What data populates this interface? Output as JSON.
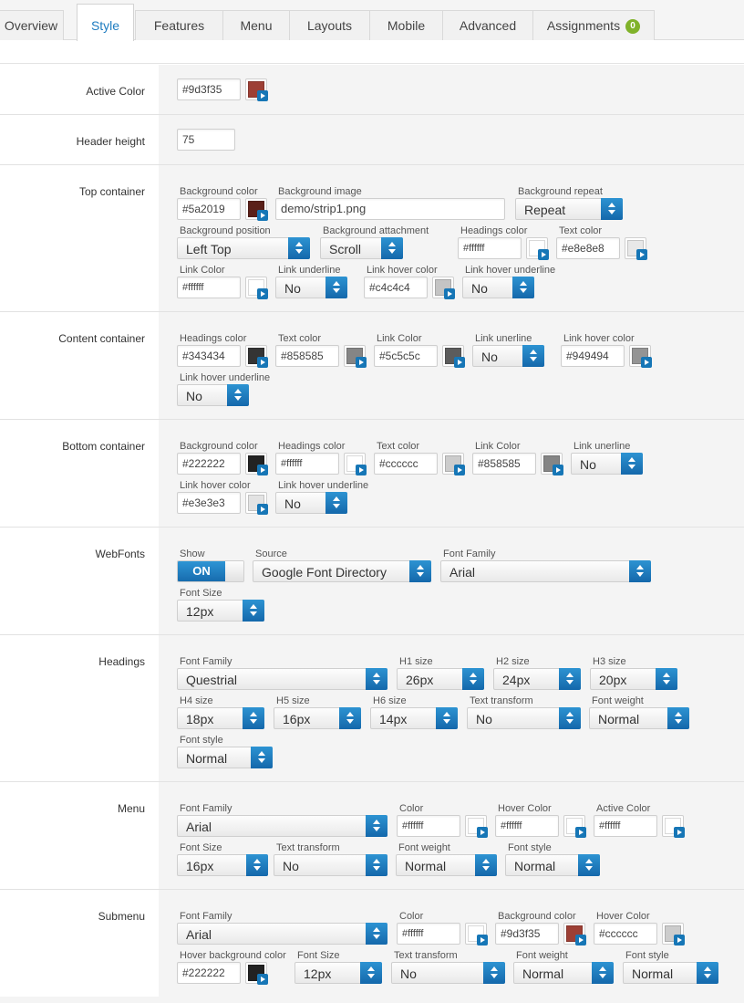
{
  "tabs": [
    {
      "label": "Overview"
    },
    {
      "label": "Style"
    },
    {
      "label": "Features"
    },
    {
      "label": "Menu"
    },
    {
      "label": "Layouts"
    },
    {
      "label": "Mobile"
    },
    {
      "label": "Advanced"
    },
    {
      "label": "Assignments",
      "badge": "0"
    }
  ],
  "active_color": {
    "label": "Active Color",
    "value": "#9d3f35",
    "swatch": "#9d3f35"
  },
  "header_height": {
    "label": "Header height",
    "value": "75"
  },
  "top_container": {
    "label": "Top container",
    "bg_color_label": "Background color",
    "bg_color": "#5a2019",
    "bg_color_swatch": "#5a2019",
    "bg_image_label": "Background image",
    "bg_image": "demo/strip1.png",
    "bg_repeat_label": "Background repeat",
    "bg_repeat": "Repeat",
    "bg_position_label": "Background position",
    "bg_position": "Left Top",
    "bg_attach_label": "Background attachment",
    "bg_attach": "Scroll",
    "headings_color_label": "Headings color",
    "headings_color": "#ffffff",
    "headings_swatch": "#ffffff",
    "text_color_label": "Text color",
    "text_color": "#e8e8e8",
    "text_swatch": "#e8e8e8",
    "link_color_label": "Link Color",
    "link_color": "#ffffff",
    "link_swatch": "#ffffff",
    "link_underline_label": "Link underline",
    "link_underline": "No",
    "link_hover_color_label": "Link hover color",
    "link_hover_color": "#c4c4c4",
    "link_hover_swatch": "#c4c4c4",
    "link_hover_underline_label": "Link hover underline",
    "link_hover_underline": "No"
  },
  "content_container": {
    "label": "Content container",
    "headings_color_label": "Headings color",
    "headings_color": "#343434",
    "headings_swatch": "#343434",
    "text_color_label": "Text color",
    "text_color": "#858585",
    "text_swatch": "#858585",
    "link_color_label": "Link Color",
    "link_color": "#5c5c5c",
    "link_swatch": "#5c5c5c",
    "link_underline_label": "Link unerline",
    "link_underline": "No",
    "link_hover_color_label": "Link hover color",
    "link_hover_color": "#949494",
    "link_hover_swatch": "#949494",
    "link_hover_underline_label": "Link hover underline",
    "link_hover_underline": "No"
  },
  "bottom_container": {
    "label": "Bottom container",
    "bg_color_label": "Background color",
    "bg_color": "#222222",
    "bg_swatch": "#222222",
    "headings_color_label": "Headings color",
    "headings_color": "#ffffff",
    "headings_swatch": "#ffffff",
    "text_color_label": "Text color",
    "text_color": "#cccccc",
    "text_swatch": "#cccccc",
    "link_color_label": "Link Color",
    "link_color": "#858585",
    "link_swatch": "#858585",
    "link_underline_label": "Link unerline",
    "link_underline": "No",
    "link_hover_color_label": "Link hover color",
    "link_hover_color": "#e3e3e3",
    "link_hover_swatch": "#e3e3e3",
    "link_hover_underline_label": "Link hover underline",
    "link_hover_underline": "No"
  },
  "webfonts": {
    "label": "WebFonts",
    "show_label": "Show",
    "show": "ON",
    "source_label": "Source",
    "source": "Google Font Directory",
    "family_label": "Font Family",
    "family": "Arial",
    "size_label": "Font Size",
    "size": "12px"
  },
  "headings": {
    "label": "Headings",
    "family_label": "Font Family",
    "family": "Questrial",
    "h1_label": "H1 size",
    "h1": "26px",
    "h2_label": "H2 size",
    "h2": "24px",
    "h3_label": "H3 size",
    "h3": "20px",
    "h4_label": "H4 size",
    "h4": "18px",
    "h5_label": "H5 size",
    "h5": "16px",
    "h6_label": "H6 size",
    "h6": "14px",
    "transform_label": "Text transform",
    "transform": "No",
    "weight_label": "Font weight",
    "weight": "Normal",
    "style_label": "Font style",
    "style": "Normal"
  },
  "menu": {
    "label": "Menu",
    "family_label": "Font Family",
    "family": "Arial",
    "color_label": "Color",
    "color": "#ffffff",
    "color_swatch": "#ffffff",
    "hover_label": "Hover Color",
    "hover": "#ffffff",
    "hover_swatch": "#ffffff",
    "active_label": "Active Color",
    "active": "#ffffff",
    "active_swatch": "#ffffff",
    "size_label": "Font Size",
    "size": "16px",
    "transform_label": "Text transform",
    "transform": "No",
    "weight_label": "Font weight",
    "weight": "Normal",
    "style_label": "Font style",
    "style": "Normal"
  },
  "submenu": {
    "label": "Submenu",
    "family_label": "Font Family",
    "family": "Arial",
    "color_label": "Color",
    "color": "#ffffff",
    "color_swatch": "#ffffff",
    "bg_label": "Background color",
    "bg": "#9d3f35",
    "bg_swatch": "#9d3f35",
    "hover_label": "Hover Color",
    "hover": "#cccccc",
    "hover_swatch": "#cccccc",
    "hover_bg_label": "Hover background color",
    "hover_bg": "#222222",
    "hover_bg_swatch": "#222222",
    "size_label": "Font Size",
    "size": "12px",
    "transform_label": "Text transform",
    "transform": "No",
    "weight_label": "Font weight",
    "weight": "Normal",
    "style_label": "Font style",
    "style": "Normal"
  },
  "colors": {
    "accent": "#1e7cc0",
    "badge": "#80b22a",
    "select_button": "#1a72b4"
  }
}
